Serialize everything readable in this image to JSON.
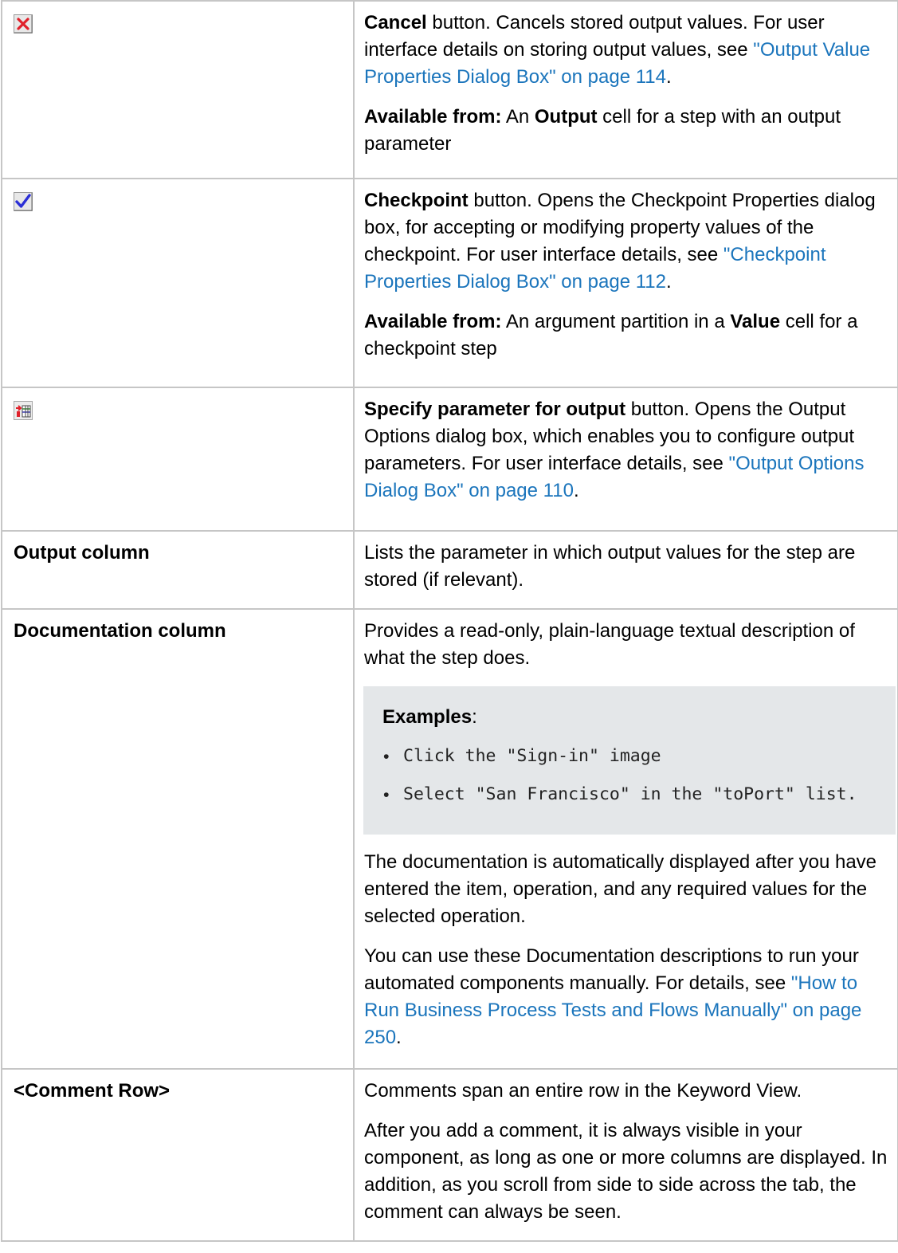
{
  "rows": [
    {
      "icon": "cancel-x-icon",
      "desc": {
        "cancel_label": "Cancel",
        "cancel_text_1": " button. Cancels stored output values. For user interface details on storing output values, see ",
        "cancel_link": "\"Output Value Properties Dialog Box\" on page 114",
        "cancel_text_2": ".",
        "avail_label": "Available from:",
        "avail_text_1": " An ",
        "avail_bold": "Output",
        "avail_text_2": " cell for a step with an output parameter"
      }
    },
    {
      "icon": "checkpoint-check-icon",
      "desc": {
        "label": "Checkpoint",
        "text_1": " button. Opens the Checkpoint Properties dialog box, for accepting or modifying property values of the checkpoint. For user interface details, see ",
        "link": "\"Checkpoint Properties Dialog Box\" on page 112",
        "text_2": ".",
        "avail_label": "Available from:",
        "avail_text_1": " An argument partition in a ",
        "avail_bold": "Value",
        "avail_text_2": " cell for a checkpoint step"
      }
    },
    {
      "icon": "parameter-output-icon",
      "desc": {
        "label": "Specify parameter for output",
        "text_1": " button. Opens the Output Options dialog box, which enables you to configure output parameters. For user interface details, see ",
        "link": "\"Output Options Dialog Box\" on page 110",
        "text_2": "."
      }
    },
    {
      "term": "Output column",
      "desc": {
        "text": "Lists the parameter in which output values for the step are stored (if relevant)."
      }
    },
    {
      "term": "Documentation column",
      "desc": {
        "intro": "Provides a read-only, plain-language textual description of what the step does.",
        "examples_title": "Examples",
        "examples_colon": ":",
        "examples": [
          "Click the \"Sign-in\" image",
          "Select \"San Francisco\" in the \"toPort\" list."
        ],
        "para2": "The documentation is automatically displayed after you have entered the item, operation, and any required values for the selected operation.",
        "para3_text": "You can use these Documentation descriptions to run your automated components manually. For details, see ",
        "para3_link": "\"How to Run Business Process Tests and Flows Manually\" on page 250",
        "para3_end": "."
      }
    },
    {
      "term": "<Comment Row>",
      "desc": {
        "para1": "Comments span an entire row in the Keyword View.",
        "para2": "After you add a comment, it is always visible in your component, as long as one or more columns are displayed. In addition, as you scroll from side to side across the tab, the comment can always be seen."
      }
    }
  ],
  "colors": {
    "link": "#1b75bc",
    "border": "#c6c6c6",
    "example_bg": "#e4e7e9",
    "cancel_icon": "#e0202a",
    "check_icon": "#2b2fd6"
  }
}
